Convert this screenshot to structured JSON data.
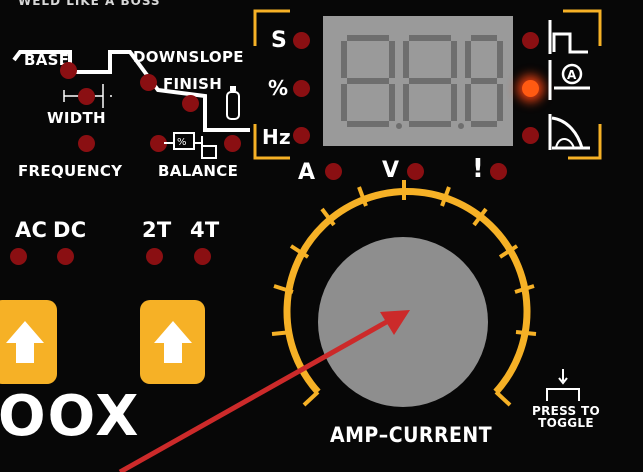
{
  "panel": {
    "top_text": "WELD LIKE A BOSS",
    "pulse_labels": {
      "base": "BASE",
      "downslope": "DOWNSLOPE",
      "finish": "FINISH",
      "width": "WIDTH",
      "frequency": "FREQUENCY",
      "balance": "BALANCE"
    },
    "display": {
      "value": "8.8.8",
      "left_units": [
        "S",
        "%",
        "Hz"
      ],
      "bottom_units": [
        "A",
        "V",
        "!"
      ]
    },
    "modes": {
      "ac": "AC",
      "dc": "DC",
      "two_t": "2T",
      "four_t": "4T"
    },
    "brand": "OOX",
    "knob_label": "AMP–CURRENT",
    "press_to_toggle": "PRESS TO TOGGLE",
    "press_line1": "PRESS TO",
    "press_line2": "TOGGLE"
  },
  "colors": {
    "accent": "#f6b126",
    "led_off": "#8a0f12",
    "led_on": "#ff5a12",
    "knob": "#8e8e8e",
    "arrow": "#cc2a2a"
  },
  "icons": {
    "pulse_wave": "pulse-wave-icon",
    "arc_start": "arc-start-icon",
    "downslope_curve": "downslope-curve-icon",
    "gas_bottle": "gas-bottle-icon",
    "balance": "balance-icon",
    "up_arrow": "up-arrow-icon"
  }
}
